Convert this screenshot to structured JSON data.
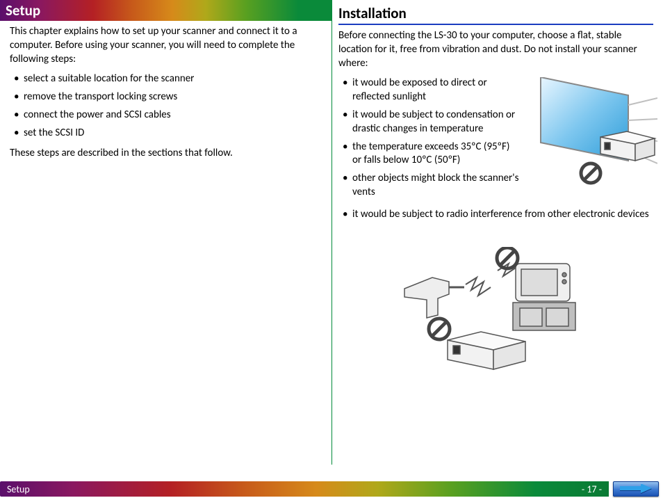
{
  "left": {
    "title": "Setup",
    "intro": "This chapter explains how to set up your scanner and connect it to a computer.  Before using your scanner, you will need to complete the following steps:",
    "steps": [
      "select a suitable location for the scanner",
      "remove the transport locking screws",
      "connect the power and SCSI cables",
      "set the SCSI ID"
    ],
    "outro": "These steps are described in the sections that follow."
  },
  "right": {
    "title": "Installation",
    "intro": "Before connecting the LS-30 to your computer, choose a flat, stable location for it, free from vibration and dust.  Do not install your scanner where:",
    "warnings": [
      "it would be exposed to direct or reflected sunlight",
      "it would be subject to condensation or drastic changes in temperature",
      "the temperature exceeds 35ºC (95ºF) or falls below 10ºC (50ºF)",
      "other objects might block the scanner's vents",
      "it would be subject to radio interference from other electronic devices"
    ]
  },
  "footer": {
    "section": "Setup",
    "page": "- 17 -"
  },
  "illustrations": {
    "fig1_desc": "Scanner near a sunlit window with a prohibition symbol",
    "fig2_desc": "Scanner near a drill and TV emitting interference, each with prohibition symbols"
  }
}
